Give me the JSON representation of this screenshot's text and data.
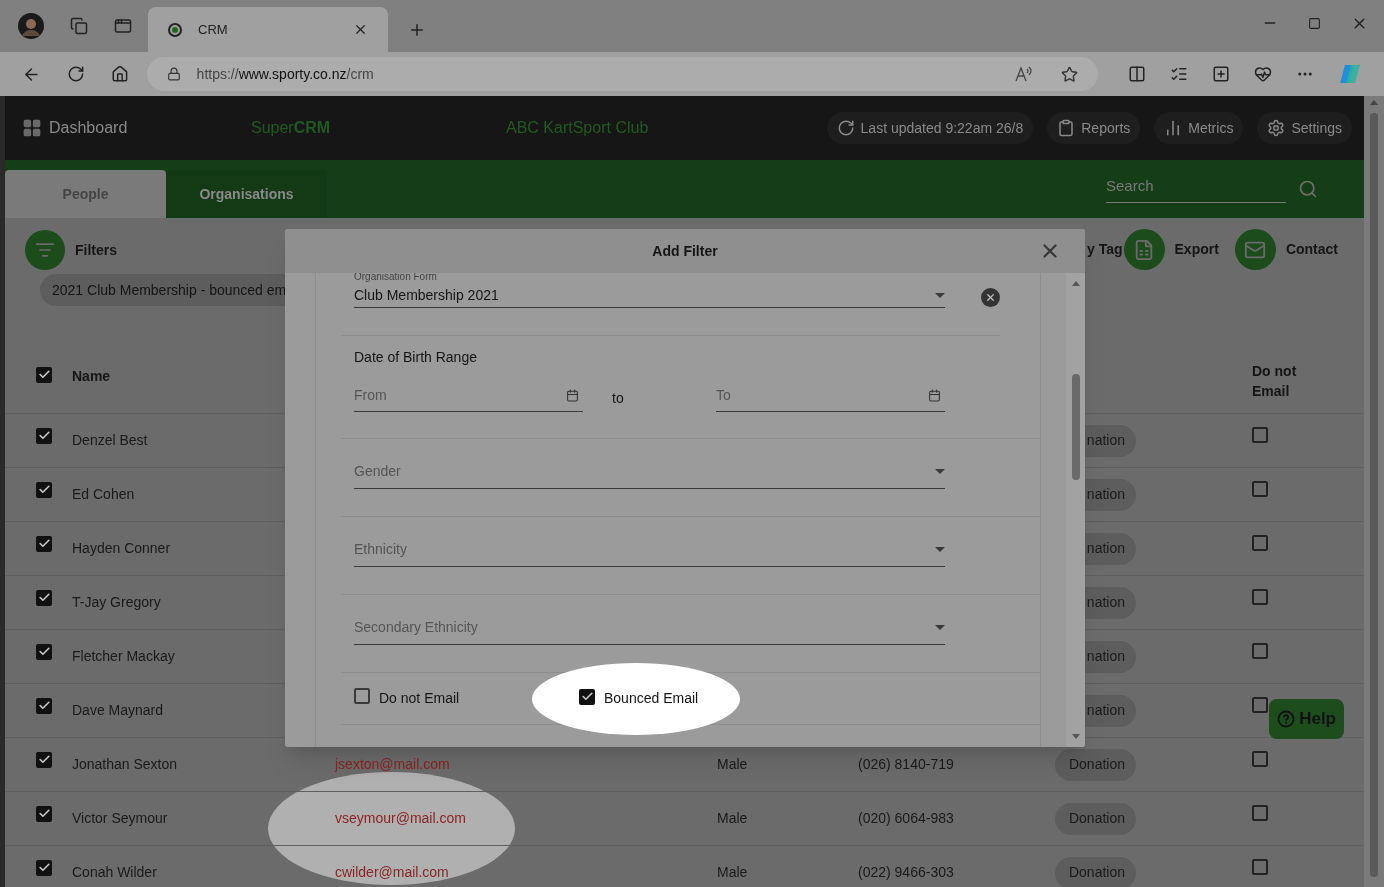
{
  "browser": {
    "tabs": [
      {
        "title": "CRM",
        "selected": true
      }
    ],
    "url": {
      "scheme": "https://",
      "host": "www.sporty.co.nz",
      "path": "/crm"
    }
  },
  "header": {
    "dashboard": "Dashboard",
    "brand": "Super**CRM**",
    "organisation": "ABC KartSport Club",
    "buttons": [
      {
        "label": "Last updated 9:22am 26/8",
        "kind": "refresh"
      },
      {
        "label": "Reports",
        "kind": "clipboard"
      },
      {
        "label": "Metrics",
        "kind": "chart"
      },
      {
        "label": "Settings",
        "kind": "gear"
      }
    ]
  },
  "nav": {
    "tabs": [
      {
        "label": "People",
        "selected": true
      },
      {
        "label": "Organisations",
        "selected": false
      }
    ],
    "search": {
      "placeholder": "Search"
    }
  },
  "toolbar": {
    "filters": "Filters",
    "chip": "2021 Club Membership - bounced em",
    "actions": [
      {
        "label": "y Tag",
        "kind": "none"
      },
      {
        "label": "Export",
        "kind": "excel"
      },
      {
        "label": "Contact",
        "kind": "mail"
      }
    ]
  },
  "table": {
    "select_all": true,
    "columns": {
      "name": "Name",
      "do_not_email": "Do not Email"
    },
    "rows": [
      {
        "name": "Denzel Best",
        "tag": "nation",
        "selected": true,
        "do_not_email": false
      },
      {
        "name": "Ed Cohen",
        "tag": "nation",
        "selected": true,
        "do_not_email": false
      },
      {
        "name": "Hayden Conner",
        "tag": "nation",
        "selected": true,
        "do_not_email": false
      },
      {
        "name": "T-Jay Gregory",
        "tag": "nation",
        "selected": true,
        "do_not_email": false
      },
      {
        "name": "Fletcher Mackay",
        "tag": "nation",
        "selected": true,
        "do_not_email": false
      },
      {
        "name": "Dave Maynard",
        "tag": "nation",
        "selected": true,
        "do_not_email": false
      },
      {
        "name": "Jonathan Sexton",
        "email": "jsexton@mail.com",
        "gender": "Male",
        "phone": "(026) 8140-719",
        "tag": "Donation",
        "selected": true,
        "do_not_email": false
      },
      {
        "name": "Victor Seymour",
        "email": "vseymour@mail.com",
        "gender": "Male",
        "phone": "(020) 6064-983",
        "tag": "Donation",
        "selected": true,
        "do_not_email": false,
        "highlighted": true
      },
      {
        "name": "Conah Wilder",
        "email": "cwilder@mail.com",
        "gender": "Male",
        "phone": "(022) 9466-303",
        "tag": "Donation",
        "selected": true,
        "do_not_email": false
      }
    ]
  },
  "modal": {
    "title": "Add Filter",
    "organisation_form": {
      "label": "Organisation Form",
      "value": "Club Membership 2021"
    },
    "date_of_birth": {
      "label": "Date of Birth Range",
      "from": "From",
      "separator": "to",
      "to": "To"
    },
    "selects": [
      {
        "placeholder": "Gender"
      },
      {
        "placeholder": "Ethnicity"
      },
      {
        "placeholder": "Secondary Ethnicity"
      }
    ],
    "checkboxes": [
      {
        "label": "Do not Email",
        "checked": false,
        "highlighted": false
      },
      {
        "label": "Bounced Email",
        "checked": true,
        "highlighted": true
      }
    ]
  },
  "help": "Help"
}
